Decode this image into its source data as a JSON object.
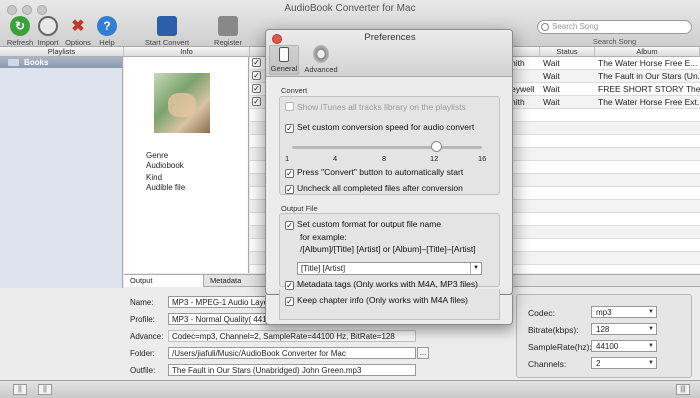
{
  "window": {
    "title": "AudioBook Converter for Mac"
  },
  "toolbar": {
    "refresh": "Refresh",
    "import": "Import",
    "options": "Options",
    "help": "Help",
    "start_convert": "Start Convert",
    "register": "Register",
    "search_placeholder": "Search Song",
    "search_label": "Search Song"
  },
  "headers": {
    "playlists": "Playlists",
    "info": "Info",
    "status": "Status",
    "album": "Album"
  },
  "sidebar": {
    "items": [
      {
        "label": "Books"
      }
    ]
  },
  "info": {
    "genre_label": "Genre",
    "genre_value": "Audiobook",
    "kind_label": "Kind",
    "kind_value": "Audible file"
  },
  "rows": [
    {
      "author": "nith",
      "status": "Wait",
      "album": "The Water Horse Free E..."
    },
    {
      "author": "",
      "status": "Wait",
      "album": "The Fault in Our Stars (Un..."
    },
    {
      "author": "eywell",
      "status": "Wait",
      "album": "FREE SHORT STORY The T..."
    },
    {
      "author": "nith",
      "status": "Wait",
      "album": "The Water Horse Free Ext..."
    },
    {
      "author": "",
      "status": "",
      "album": ""
    },
    {
      "author": "",
      "status": "",
      "album": ""
    },
    {
      "author": "",
      "status": "",
      "album": ""
    },
    {
      "author": "",
      "status": "",
      "album": ""
    },
    {
      "author": "",
      "status": "",
      "album": ""
    },
    {
      "author": "",
      "status": "",
      "album": ""
    }
  ],
  "tabs": {
    "output": "Output",
    "metadata": "Metadata"
  },
  "output": {
    "name_label": "Name:",
    "name_value": "MP3 - MPEG-1 Audio Laye",
    "profile_label": "Profile:",
    "profile_value": "MP3 - Normal Quality( 441",
    "advance_label": "Advance:",
    "advance_value": "Codec=mp3, Channel=2, SampleRate=44100 Hz, BitRate=128",
    "folder_label": "Folder:",
    "folder_value": "/Users/jiafuli/Music/AudioBook Converter for Mac",
    "browse": "...",
    "outfile_label": "Outfile:",
    "outfile_value": "The Fault in Our Stars (Unabridged) John Green.mp3"
  },
  "settings": {
    "codec_label": "Codec:",
    "codec_value": "mp3",
    "bitrate_label": "Bitrate(kbps):",
    "bitrate_value": "128",
    "samplerate_label": "SampleRate(hz):",
    "samplerate_value": "44100",
    "channels_label": "Channels:",
    "channels_value": "2"
  },
  "statusbar": {
    "left1": "||",
    "left2": "||",
    "right": "|||"
  },
  "dialog": {
    "title": "Preferences",
    "tab_general": "General",
    "tab_advanced": "Advanced",
    "convert_group": "Convert",
    "show_itunes": "Show iTunes all tracks library on the playlists",
    "custom_speed": "Set custom conversion speed for audio convert",
    "speed_value": 12,
    "speed_ticks": [
      "1",
      "4",
      "8",
      "12",
      "16"
    ],
    "press_convert": "Press \"Convert\" button to automatically start",
    "uncheck_completed": "Uncheck all completed files after conversion",
    "output_group": "Output File",
    "custom_format": "Set custom format for output file name",
    "for_example": "for example:",
    "example_formats": "/[Album]/[Title] [Artist] or [Album]–[Title]–[Artist]",
    "format_value": "[Title] [Artist]",
    "metadata_tags": "Metadata tags (Only works with M4A, MP3 files)",
    "chapter_info": "Keep chapter info (Only works with M4A files)",
    "check": "✓"
  }
}
